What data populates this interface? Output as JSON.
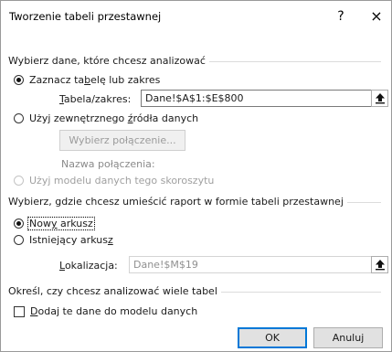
{
  "dialog": {
    "title": "Tworzenie tabeli przestawnej",
    "help_symbol": "?",
    "close_symbol": "×"
  },
  "choose_data": {
    "group_label": "Wybierz dane, które chcesz analizować",
    "option_range": {
      "label_pre": "Zaznacz ta",
      "label_acc": "b",
      "label_post": "elę lub zakres",
      "checked": true
    },
    "range_field": {
      "label_acc": "T",
      "label_post": "abela/zakres:",
      "value": "Dane!$A$1:$E$800"
    },
    "option_external": {
      "label_pre": "Użyj zewnętrznego ",
      "label_acc": "ź",
      "label_post": "ródła danych",
      "checked": false
    },
    "choose_connection_button": "Wybierz połączenie...",
    "connection_name_label": "Nazwa połączenia:",
    "option_data_model": {
      "label": "Użyj modelu danych tego skoroszytu",
      "checked": false,
      "disabled": true
    }
  },
  "placement": {
    "group_label": "Wybierz, gdzie chcesz umieścić raport w formie tabeli przestawnej",
    "option_new_sheet": {
      "label_pre": "Now",
      "label_acc": "y",
      "label_post": " arkusz",
      "checked": true
    },
    "option_existing_sheet": {
      "label_pre": "Istniejący arkus",
      "label_acc": "z",
      "label_post": "",
      "checked": false
    },
    "location_field": {
      "label_acc": "L",
      "label_post": "okalizacja:",
      "value": "Dane!$M$19"
    }
  },
  "multiple_tables": {
    "group_label": "Określ, czy chcesz analizować wiele tabel",
    "add_to_model": {
      "label_acc": "D",
      "label_post": "odaj te dane do modelu danych",
      "checked": false
    }
  },
  "buttons": {
    "ok": "OK",
    "cancel": "Anuluj"
  },
  "colors": {
    "default_button_border": "#0078d7",
    "button_face": "#e1e1e1",
    "disabled_text": "#a0a0a0"
  }
}
